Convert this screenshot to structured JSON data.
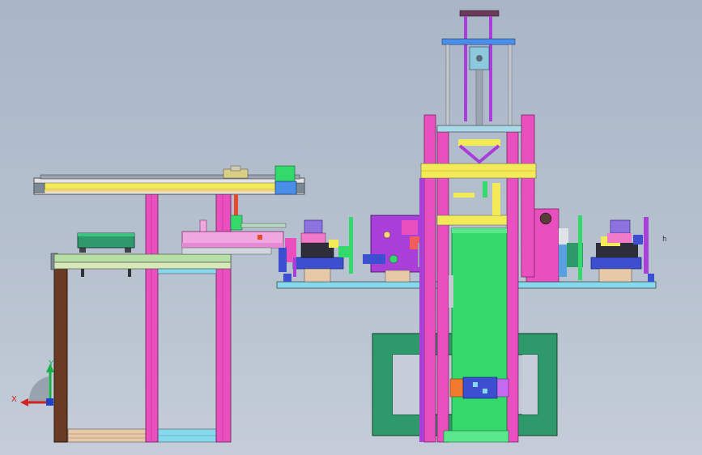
{
  "viewport": {
    "background_top": "#a9b6c6",
    "background_bottom": "#c4cdd8"
  },
  "triad": {
    "x_label": "X",
    "y_label": "Y",
    "x_color": "#d42020",
    "y_color": "#19b04a",
    "z_color": "#2140c8"
  },
  "side_mark": "h",
  "palette": {
    "magenta": "#ea4fbf",
    "green": "#33d96b",
    "teal": "#2e9a6c",
    "yellow": "#f2ea57",
    "purple": "#a93fd8",
    "blue": "#3d4fd1",
    "brown": "#6b3a22",
    "lightblue": "#86d8ec",
    "grey": "#8f98a3"
  }
}
